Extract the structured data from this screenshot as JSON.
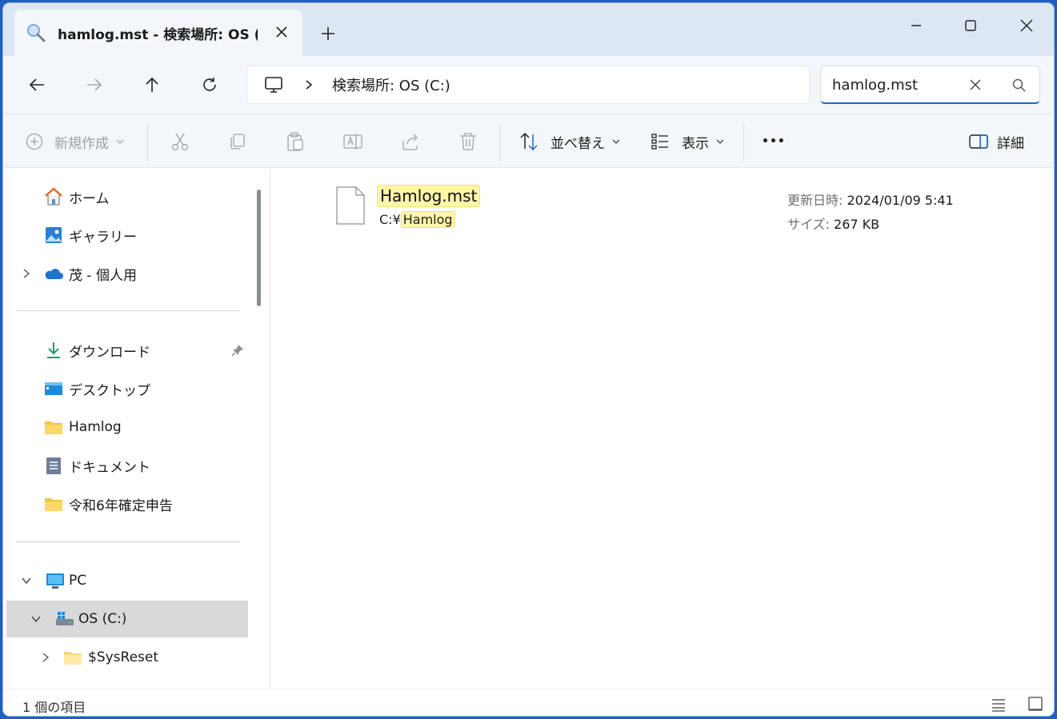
{
  "tab": {
    "title": "hamlog.mst - 検索場所: OS (C:",
    "icon": "search-icon"
  },
  "window_controls": [
    "minimize",
    "maximize",
    "close"
  ],
  "address": {
    "location": "検索場所: OS (C:)",
    "separator": ">"
  },
  "search": {
    "value": "hamlog.mst"
  },
  "toolbar": {
    "new_label": "新規作成",
    "sort_label": "並べ替え",
    "view_label": "表示",
    "more_label": "•••",
    "details_label": "詳細"
  },
  "sidebar": {
    "home": "ホーム",
    "gallery": "ギャラリー",
    "onedrive": "茂 - 個人用",
    "downloads": "ダウンロード",
    "desktop": "デスクトップ",
    "hamlog": "Hamlog",
    "documents": "ドキュメント",
    "tax": "令和6年確定申告",
    "pc": "PC",
    "osc": "OS (C:)",
    "sysreset": "$SysReset"
  },
  "results": [
    {
      "name": "Hamlog.mst",
      "path_prefix": "C:¥",
      "path_highlight": "Hamlog",
      "modified_label": "更新日時:",
      "modified_value": "2024/01/09 5:41",
      "size_label": "サイズ:",
      "size_value": "267 KB"
    }
  ],
  "status": {
    "count": "1 個の項目"
  },
  "colors": {
    "accent": "#1b6ac9",
    "highlight": "#fff6a8",
    "selected": "#d9d9d9"
  }
}
